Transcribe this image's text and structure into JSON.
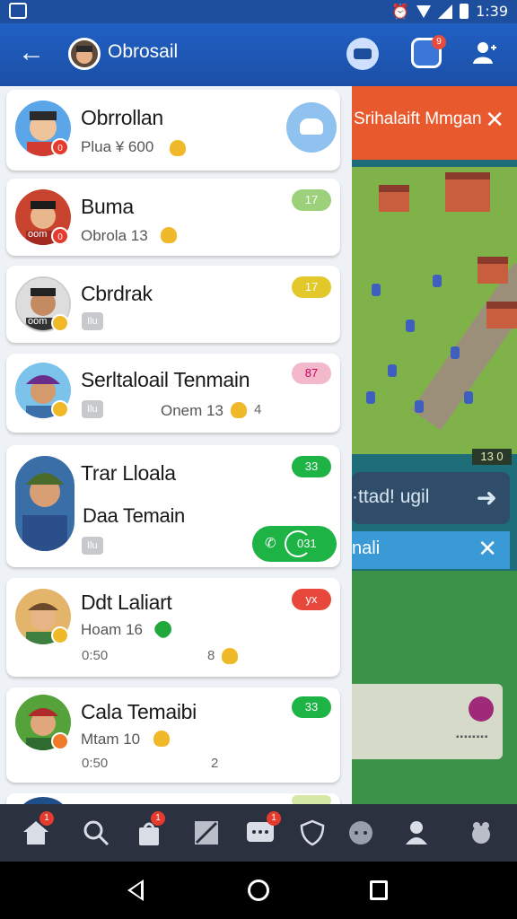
{
  "status_bar": {
    "time": "1:39"
  },
  "app_bar": {
    "title": "Obrosail",
    "notification_count": "9"
  },
  "game_background": {
    "notification1": {
      "text": "Srihalaift Mmgan"
    },
    "counter": "13 0",
    "dark_button": {
      "text": "·ttad! ugil"
    },
    "notification2": {
      "text": "nali"
    },
    "info_card_label": "▪▪▪▪▪▪▪▪"
  },
  "chats": [
    {
      "name": "Obrrollan",
      "sub": "Plua ¥ 600",
      "avatar_color": "#5aa6e8",
      "badge": "0",
      "badge_color": "#e53b2e"
    },
    {
      "name": "Buma",
      "sub": "Obrola 13",
      "tag": "17",
      "tag_color": "#9cd07a",
      "avatar_color": "#c8442f",
      "avatar_label": "oom",
      "badge": "0",
      "badge_color": "#e53b2e"
    },
    {
      "name": "Cbrdrak",
      "chip": "Ilu",
      "tag": "17",
      "tag_color": "#e2c82b",
      "avatar_color": "#dddddd",
      "avatar_label": "oom",
      "badge": "",
      "badge_color": "#f0b92a"
    },
    {
      "name": "Serltaloail Tenmain",
      "chip": "Ilu",
      "sub": "Onem 13",
      "trail": "4",
      "tag": "87",
      "tag_color": "#f3b8c9",
      "avatar_color": "#7bc3ea",
      "badge": "",
      "badge_color": "#f0b92a"
    },
    {
      "name": "Trar Lloala",
      "name2": "Daa Temain",
      "chip": "Ilu",
      "tag": "33",
      "tag_color": "#1db345",
      "call": {
        "label": "031"
      },
      "avatar_color": "#3a6ea6"
    },
    {
      "name": "Ddt Laliart",
      "sub": "Hoam 16",
      "time": "0:50",
      "trail": "8",
      "tag": "yx",
      "tag_color": "#e8483b",
      "avatar_color": "#e3b56a",
      "badge": "",
      "badge_color": "#f0b92a"
    },
    {
      "name": "Cala Temaibi",
      "sub": "Mtam 10",
      "time": "0:50",
      "trail": "2",
      "tag": "33",
      "tag_color": "#1db345",
      "avatar_color": "#55a13a",
      "badge": "",
      "badge_color": "#f07a2a"
    }
  ],
  "bottom_nav": {
    "items": [
      "home-icon",
      "search-icon",
      "bag-icon",
      "edit-icon",
      "chat-icon",
      "shield-icon",
      "dots-icon",
      "profile-icon",
      "hand-icon"
    ],
    "badges": [
      "1",
      "1",
      "1"
    ]
  }
}
